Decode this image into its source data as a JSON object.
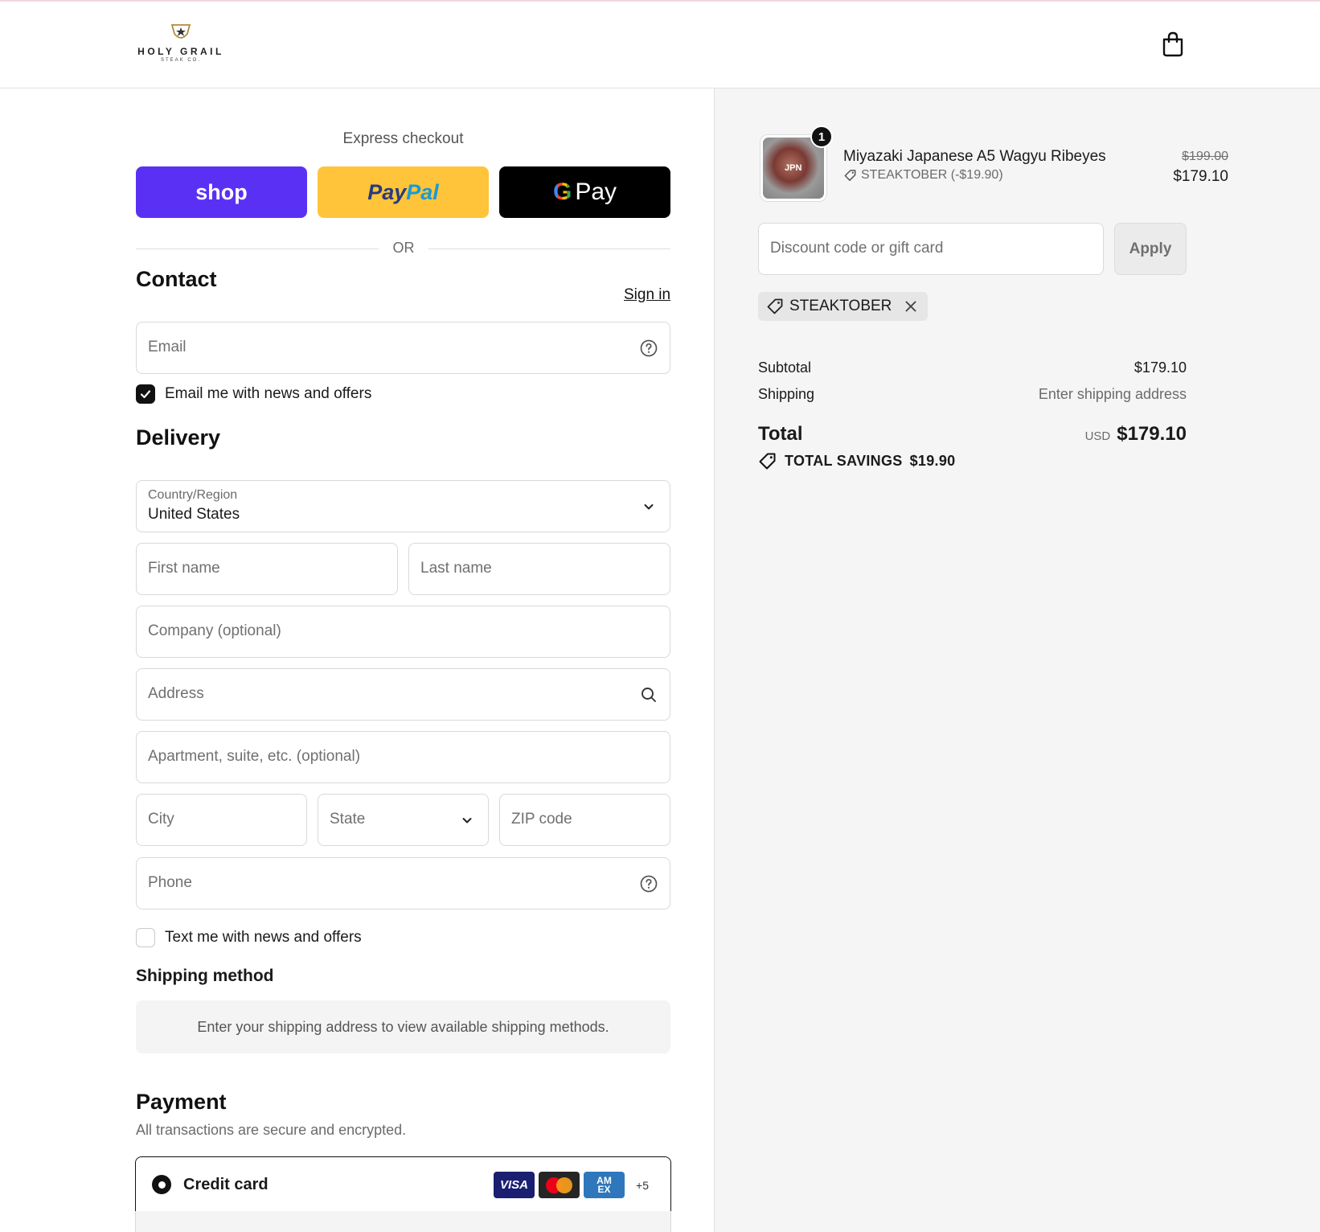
{
  "brand": {
    "name": "HOLY GRAIL",
    "sub": "STEAK CO."
  },
  "express": {
    "title": "Express checkout",
    "shop_label": "shop",
    "paypal_label_1": "Pay",
    "paypal_label_2": "Pal",
    "gpay_g": "G",
    "gpay_label": "Pay",
    "or_label": "OR"
  },
  "contact": {
    "title": "Contact",
    "signin_label": "Sign in",
    "email_placeholder": "Email",
    "email_opt_in": "Email me with news and offers",
    "email_opt_in_checked": true
  },
  "delivery": {
    "title": "Delivery",
    "country_label": "Country/Region",
    "country_value": "United States",
    "first_name_placeholder": "First name",
    "last_name_placeholder": "Last name",
    "company_placeholder": "Company (optional)",
    "address_placeholder": "Address",
    "apartment_placeholder": "Apartment, suite, etc. (optional)",
    "city_placeholder": "City",
    "state_placeholder": "State",
    "zip_placeholder": "ZIP code",
    "phone_placeholder": "Phone",
    "sms_opt_in": "Text me with news and offers",
    "sms_opt_in_checked": false
  },
  "shipping_method": {
    "title": "Shipping method",
    "notice": "Enter your shipping address to view available shipping methods."
  },
  "payment": {
    "title": "Payment",
    "subtitle": "All transactions are secure and encrypted.",
    "method_label": "Credit card",
    "cards": [
      "VISA",
      "Mastercard",
      "AMEX"
    ],
    "more_cards": "+5"
  },
  "summary": {
    "item": {
      "name": "Miyazaki Japanese A5 Wagyu Ribeyes",
      "discount": "STEAKTOBER (-$19.90)",
      "original_price": "$199.00",
      "price": "$179.10",
      "quantity": "1",
      "image_text": "JPN"
    },
    "discount_placeholder": "Discount code or gift card",
    "apply_label": "Apply",
    "applied_code": "STEAKTOBER",
    "subtotal_label": "Subtotal",
    "subtotal_value": "$179.10",
    "shipping_label": "Shipping",
    "shipping_value": "Enter shipping address",
    "total_label": "Total",
    "currency": "USD",
    "total_value": "$179.10",
    "savings_label": "TOTAL SAVINGS",
    "savings_value": "$19.90"
  }
}
